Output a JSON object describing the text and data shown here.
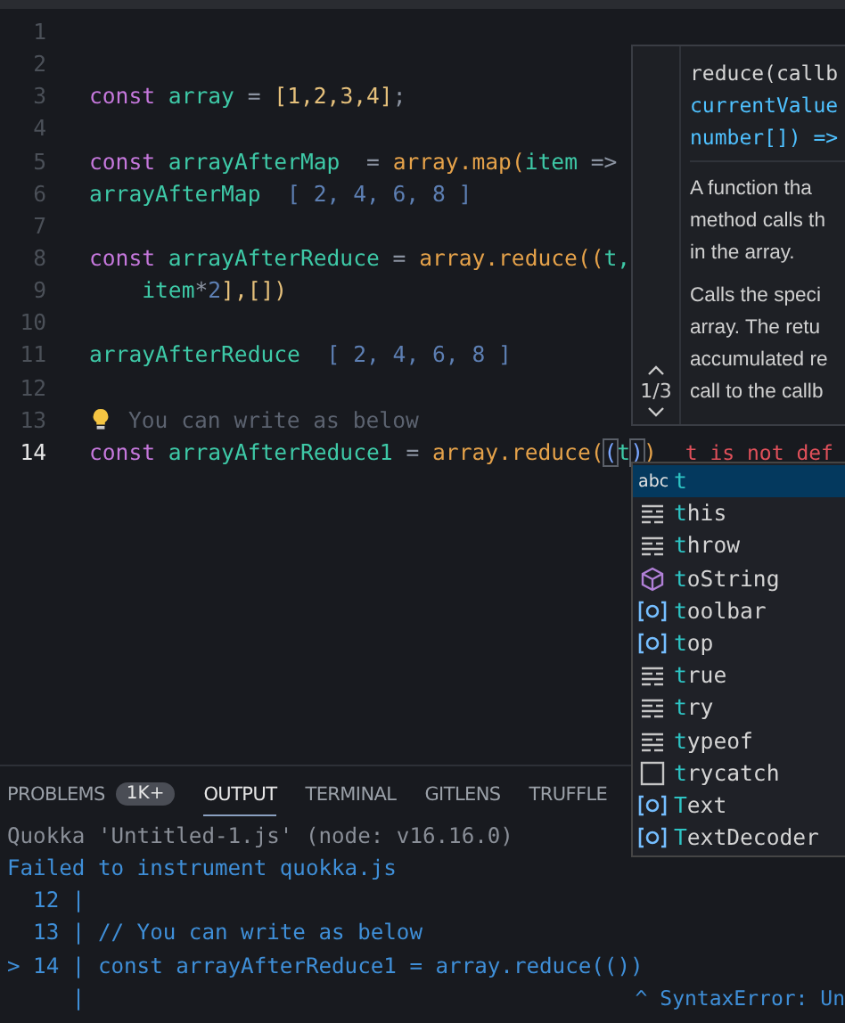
{
  "editor": {
    "lines": [
      {
        "number": "1",
        "current": false
      },
      {
        "number": "2",
        "current": false
      },
      {
        "number": "3",
        "current": false,
        "tokens": [
          {
            "kind": "keyword",
            "text": "const"
          },
          {
            "kind": "variable",
            "text": " array"
          },
          {
            "kind": "operator",
            "text": " = "
          },
          {
            "kind": "bracket",
            "text": "[1,2,3,4]"
          },
          {
            "kind": "operator",
            "text": ";"
          }
        ]
      },
      {
        "number": "4",
        "current": false
      },
      {
        "number": "5",
        "current": false,
        "tokens": [
          {
            "kind": "keyword",
            "text": "const"
          },
          {
            "kind": "variable",
            "text": " arrayAfterMap"
          },
          {
            "kind": "operator",
            "text": "  = "
          },
          {
            "kind": "call",
            "text": "array.map("
          },
          {
            "kind": "variable",
            "text": "item"
          },
          {
            "kind": "operator",
            "text": " =>"
          }
        ]
      },
      {
        "number": "6",
        "current": false,
        "tokens": [
          {
            "kind": "variable",
            "text": "arrayAfterMap"
          },
          {
            "kind": "value",
            "text": "  [ 2, 4, 6, 8 ]"
          }
        ]
      },
      {
        "number": "7",
        "current": false
      },
      {
        "number": "8",
        "current": false,
        "tokens": [
          {
            "kind": "keyword",
            "text": "const"
          },
          {
            "kind": "variable",
            "text": " arrayAfterReduce"
          },
          {
            "kind": "operator",
            "text": " = "
          },
          {
            "kind": "call",
            "text": "array.reduce(("
          },
          {
            "kind": "variable",
            "text": "t,"
          }
        ]
      },
      {
        "number": "9",
        "current": false,
        "tokens": [
          {
            "kind": "variable",
            "text": "    item"
          },
          {
            "kind": "operator",
            "text": "*"
          },
          {
            "kind": "value",
            "text": "2"
          },
          {
            "kind": "bracket",
            "text": "],[])"
          }
        ]
      },
      {
        "number": "10",
        "current": false
      },
      {
        "number": "11",
        "current": false,
        "tokens": [
          {
            "kind": "variable",
            "text": "arrayAfterReduce"
          },
          {
            "kind": "value",
            "text": "  [ 2, 4, 6, 8 ]"
          }
        ]
      },
      {
        "number": "12",
        "current": false
      },
      {
        "number": "13",
        "current": false,
        "hint": true,
        "tokens": [
          {
            "kind": "comment",
            "text": "You can write as below"
          }
        ]
      },
      {
        "number": "14",
        "current": true,
        "tokens": [
          {
            "kind": "keyword",
            "text": "const"
          },
          {
            "kind": "variable",
            "text": " arrayAfterReduce1"
          },
          {
            "kind": "operator",
            "text": " = "
          },
          {
            "kind": "call",
            "text": "array.reduce("
          },
          {
            "kind": "paren",
            "text": "("
          },
          {
            "kind": "variable",
            "text": "t"
          },
          {
            "kind": "paren",
            "text": ")"
          },
          {
            "kind": "call",
            "text": ")"
          }
        ],
        "error": "t is not def"
      }
    ]
  },
  "signature_help": {
    "signature": [
      "reduce(callb",
      "currentValue",
      "number[]) =>"
    ],
    "counter": "1/3",
    "paragraphs": [
      [
        "A function tha",
        "method calls th",
        "in the array."
      ],
      [
        "Calls the speci",
        "array. The retu",
        "accumulated re",
        "call to the callb"
      ]
    ]
  },
  "suggestions": [
    {
      "kind": "text",
      "icon": "abc",
      "label": "t",
      "selected": true
    },
    {
      "kind": "keyword",
      "label": "this",
      "selected": false
    },
    {
      "kind": "keyword",
      "label": "throw",
      "selected": false
    },
    {
      "kind": "method",
      "label": "toString",
      "selected": false
    },
    {
      "kind": "variable",
      "label": "toolbar",
      "selected": false
    },
    {
      "kind": "variable",
      "label": "top",
      "selected": false
    },
    {
      "kind": "keyword",
      "label": "true",
      "selected": false
    },
    {
      "kind": "keyword",
      "label": "try",
      "selected": false
    },
    {
      "kind": "keyword",
      "label": "typeof",
      "selected": false
    },
    {
      "kind": "snippet",
      "label": "trycatch",
      "selected": false
    },
    {
      "kind": "variable",
      "label": "Text",
      "selected": false
    },
    {
      "kind": "variable",
      "label": "TextDecoder",
      "selected": false
    }
  ],
  "panel": {
    "tabs": [
      {
        "label": "PROBLEMS",
        "badge": "1K+",
        "selected": false
      },
      {
        "label": "OUTPUT",
        "selected": true
      },
      {
        "label": "TERMINAL",
        "selected": false
      },
      {
        "label": "GITLENS",
        "selected": false
      },
      {
        "label": "TRUFFLE",
        "selected": false
      }
    ],
    "output": [
      {
        "kind": "info",
        "text": "Quokka 'Untitled-1.js' (node: v16.16.0)"
      },
      {
        "kind": "error",
        "text": "Failed to instrument quokka.js"
      },
      {
        "kind": "code",
        "text": "  12 |"
      },
      {
        "kind": "code",
        "text": "  13 | // You can write as below"
      },
      {
        "kind": "code",
        "text": "> 14 | const arrayAfterReduce1 = array.reduce(())"
      },
      {
        "kind": "caret",
        "text": "     |",
        "message": "^ SyntaxError: Un"
      }
    ]
  }
}
